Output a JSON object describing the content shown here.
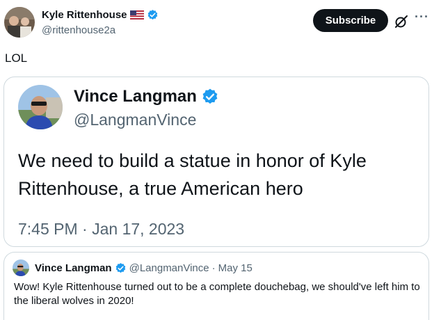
{
  "author": {
    "name": "Kyle Rittenhouse",
    "handle": "@rittenhouse2a",
    "flag_icon": "us-flag-icon",
    "verified_color": "#1d9bf0"
  },
  "actions": {
    "subscribe_label": "Subscribe",
    "grok_icon": "grok-icon",
    "more_label": "···"
  },
  "tweet": {
    "text": "LOL"
  },
  "quoted": {
    "name": "Vince Langman",
    "handle": "@LangmanVince",
    "text": "We need to build a statue in honor of Kyle Rittenhouse, a true American hero",
    "timestamp": "7:45 PM · Jan 17, 2023"
  },
  "nested": {
    "name": "Vince Langman",
    "handle": "@LangmanVince",
    "separator": "·",
    "date": "May 15",
    "text": "Wow! Kyle Rittenhouse turned out to be a complete douchebag, we should've left him to the liberal wolves in 2020!"
  }
}
